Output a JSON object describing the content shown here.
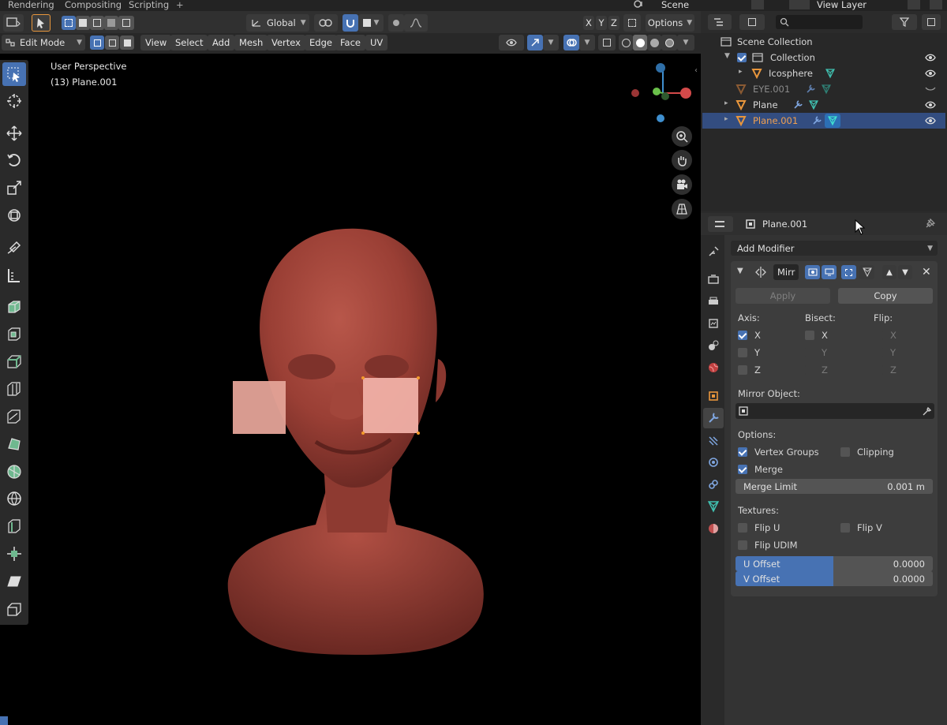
{
  "workspace_tabs": [
    "Rendering",
    "Compositing",
    "Scripting",
    "+"
  ],
  "scene_label": "Scene",
  "view_layer_label": "View Layer",
  "header": {
    "transform_orientation": "Global",
    "axis_x": "X",
    "axis_y": "Y",
    "axis_z": "Z",
    "options": "Options"
  },
  "header2": {
    "mode": "Edit Mode",
    "menus": [
      "View",
      "Select",
      "Add",
      "Mesh",
      "Vertex",
      "Edge",
      "Face",
      "UV"
    ]
  },
  "viewport": {
    "perspective": "User Perspective",
    "object_info": "(13) Plane.001"
  },
  "outliner": {
    "search_placeholder": "",
    "rows": [
      "Scene Collection",
      "Collection",
      "Icosphere",
      "EYE.001",
      "Plane",
      "Plane.001"
    ]
  },
  "properties": {
    "object_name": "Plane.001",
    "add_modifier": "Add Modifier",
    "modifier_name": "Mirr",
    "apply": "Apply",
    "copy": "Copy",
    "axis_label": "Axis:",
    "bisect_label": "Bisect:",
    "flip_label": "Flip:",
    "x": "X",
    "y": "Y",
    "z": "Z",
    "mirror_object_label": "Mirror Object:",
    "options_label": "Options:",
    "vertex_groups": "Vertex Groups",
    "clipping": "Clipping",
    "merge": "Merge",
    "merge_limit_label": "Merge Limit",
    "merge_limit_value": "0.001 m",
    "textures_label": "Textures:",
    "flip_u": "Flip U",
    "flip_v": "Flip V",
    "flip_udim": "Flip UDIM",
    "u_offset_label": "U Offset",
    "u_offset_value": "0.0000",
    "v_offset_label": "V Offset",
    "v_offset_value": "0.0000"
  },
  "colors": {
    "accent": "#4772b3",
    "selected_row": "#334d80",
    "object_orange": "#e8963c",
    "mesh_teal": "#40c0b0"
  }
}
